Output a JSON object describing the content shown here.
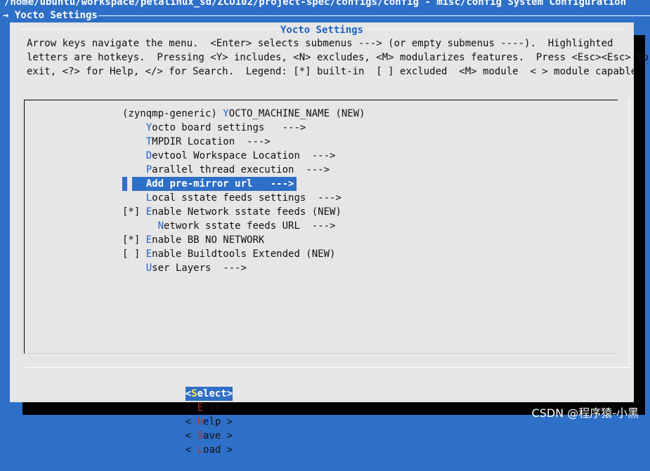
{
  "header": {
    "path": "/home/ubuntu/workspace/petalinux_sd/ZCU102/project-spec/configs/config - misc/config System Configuration",
    "breadcrumb": "→ Yocto Settings"
  },
  "dialog": {
    "title": "Yocto Settings",
    "help_lines": [
      "Arrow keys navigate the menu.  <Enter> selects submenus ---> (or empty submenus ----).  Highlighted",
      "letters are hotkeys.  Pressing <Y> includes, <N> excludes, <M> modularizes features.  Press <Esc><Esc> to",
      "exit, <?> for Help, </> for Search.  Legend: [*] built-in  [ ] excluded  <M> module  < > module capable"
    ]
  },
  "menu": {
    "items": [
      {
        "prefix": "(zynqmp-generic) ",
        "hotkey": "Y",
        "label": "OCTO_MACHINE_NAME (NEW)",
        "selected": false
      },
      {
        "prefix": "    ",
        "hotkey": "Y",
        "label": "octo board settings   --->",
        "selected": false
      },
      {
        "prefix": "    ",
        "hotkey": "T",
        "label": "MPDIR Location  --->",
        "selected": false
      },
      {
        "prefix": "    ",
        "hotkey": "D",
        "label": "evtool Workspace Location  --->",
        "selected": false
      },
      {
        "prefix": "    ",
        "hotkey": "P",
        "label": "arallel thread execution  --->",
        "selected": false
      },
      {
        "prefix": "    ",
        "hotkey": "A",
        "label": "dd pre-mirror url   --->",
        "selected": true
      },
      {
        "prefix": "    ",
        "hotkey": "L",
        "label": "ocal sstate feeds settings  --->",
        "selected": false
      },
      {
        "prefix": "[*] ",
        "hotkey": "E",
        "label": "nable Network sstate feeds (NEW)",
        "selected": false
      },
      {
        "prefix": "      ",
        "hotkey": "N",
        "label": "etwork sstate feeds URL  --->",
        "selected": false
      },
      {
        "prefix": "[*] ",
        "hotkey": "E",
        "label": "nable BB NO NETWORK",
        "selected": false
      },
      {
        "prefix": "[ ] ",
        "hotkey": "E",
        "label": "nable Buildtools Extended (NEW)",
        "selected": false
      },
      {
        "prefix": "    ",
        "hotkey": "U",
        "label": "ser Layers  --->",
        "selected": false
      }
    ]
  },
  "buttons": {
    "select": {
      "open": "<",
      "hotkey": "S",
      "rest": "elect>"
    },
    "exit": {
      "open": "< ",
      "hotkey": "E",
      "rest": "xit >"
    },
    "help": {
      "open": "< ",
      "hotkey": "H",
      "rest": "elp >"
    },
    "save": {
      "open": "< ",
      "hotkey": "S",
      "rest": "ave >"
    },
    "load": {
      "open": "< ",
      "hotkey": "L",
      "rest": "oad >"
    }
  },
  "watermark": "CSDN @程序猿-小黑",
  "colors": {
    "background": "#2e6fc7",
    "dialog": "#e6e6e6",
    "title": "#1e63c6",
    "hotkey_menu": "#1e63c6",
    "hotkey_button": "#b8322c",
    "highlight": "#2e6fc7"
  }
}
